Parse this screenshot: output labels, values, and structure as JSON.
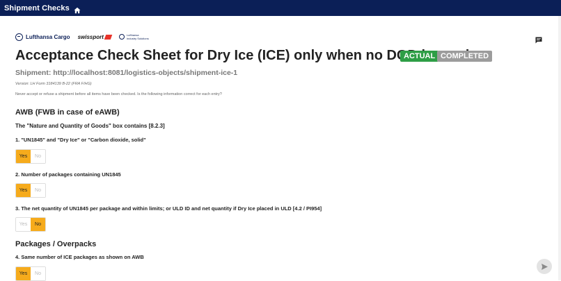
{
  "header": {
    "title": "Shipment Checks",
    "home_icon": "home-icon"
  },
  "logos": {
    "lufthansa": "Lufthansa Cargo",
    "swissport": "swissport",
    "industry_line1": "Lufthansa",
    "industry_line2": "Industry Solutions"
  },
  "page": {
    "title": "Acceptance Check Sheet for Dry Ice (ICE) only when no DGD is used",
    "badge_actual": "ACTUAL",
    "badge_completed": "COMPLETED",
    "shipment": "Shipment: http://localhost:8081/logistics-objects/shipment-ice-1",
    "version": "Version: LH Form 3184139 B-22 (FRA F/HG)",
    "note": "Never accept or refuse a shipment before all items have been checked. Is the following information correct for each entry?"
  },
  "colors": {
    "header_bg": "#0b1f57",
    "actual": "#2e9e46",
    "completed": "#9c9c9c",
    "selected": "#f6ab1c"
  },
  "sections": [
    {
      "title": "AWB (FWB in case of eAWB)",
      "subtitle": "The \"Nature and Quantity of Goods\" box contains [8.2.3]"
    },
    {
      "title": "Packages / Overpacks"
    }
  ],
  "questions": [
    {
      "label": "1. \"UN1845\" and \"Dry Ice\" or \"Carbon dioxide, solid\"",
      "yes": "Yes",
      "no": "No",
      "selected": "Yes"
    },
    {
      "label": "2. Number of packages containing UN1845",
      "yes": "Yes",
      "no": "No",
      "selected": "Yes"
    },
    {
      "label": "3. The net quantity of UN1845 per package and within limits; or ULD ID and net quantity if Dry Ice placed in ULD [4.2 / PI954]",
      "yes": "Yes",
      "no": "No",
      "selected": "No"
    },
    {
      "label": "4. Same number of ICE packages as shown on AWB",
      "yes": "Yes",
      "no": "No",
      "selected": "Yes"
    }
  ]
}
